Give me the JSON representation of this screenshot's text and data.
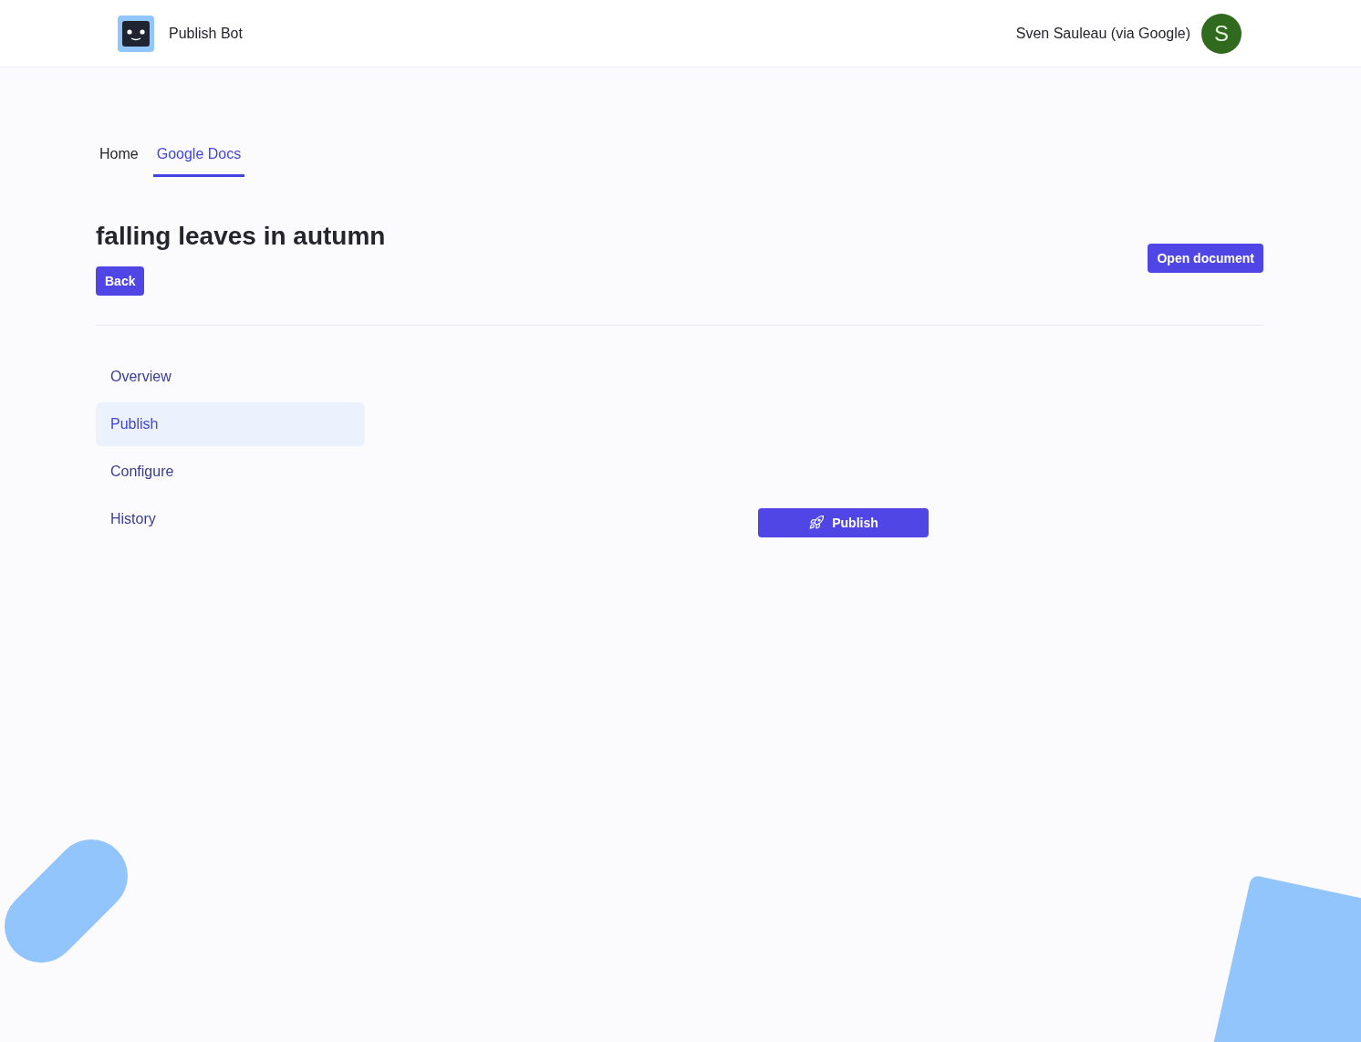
{
  "header": {
    "app_name": "Publish Bot",
    "user_name": "Sven Sauleau (via Google)",
    "avatar_initial": "S"
  },
  "tabs": [
    {
      "label": "Home",
      "selected": false
    },
    {
      "label": "Google Docs",
      "selected": true
    }
  ],
  "document": {
    "title": "falling leaves in autumn",
    "back_button": "Back",
    "open_button": "Open document"
  },
  "sidebar": {
    "items": [
      {
        "label": "Overview",
        "selected": false
      },
      {
        "label": "Publish",
        "selected": true
      },
      {
        "label": "Configure",
        "selected": false
      },
      {
        "label": "History",
        "selected": false
      }
    ]
  },
  "publish_button": "Publish"
}
